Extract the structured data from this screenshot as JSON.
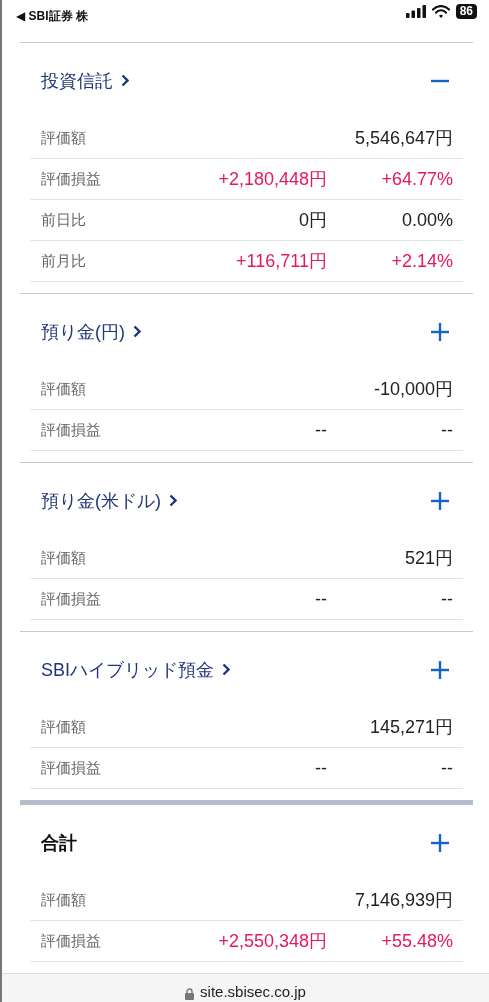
{
  "status_bar": {
    "back_label": "◀ SBI証券 株",
    "battery": "86"
  },
  "sections": [
    {
      "title": "投資信託",
      "link": true,
      "expanded": true,
      "rows": [
        {
          "label": "評価額",
          "amount": {
            "text": "5,546,647円",
            "kind": "plain"
          }
        },
        {
          "label": "評価損益",
          "amount": {
            "text": "+2,180,448円",
            "kind": "gain"
          },
          "rate": {
            "text": "+64.77%",
            "kind": "gain"
          }
        },
        {
          "label": "前日比",
          "amount": {
            "text": "0円",
            "kind": "plain"
          },
          "rate": {
            "text": "0.00%",
            "kind": "plain"
          }
        },
        {
          "label": "前月比",
          "amount": {
            "text": "+116,711円",
            "kind": "gain"
          },
          "rate": {
            "text": "+2.14%",
            "kind": "gain"
          }
        }
      ]
    },
    {
      "title": "預り金(円)",
      "link": true,
      "expanded": false,
      "rows": [
        {
          "label": "評価額",
          "amount": {
            "text": "-10,000円",
            "kind": "plain"
          }
        },
        {
          "label": "評価損益",
          "amount": {
            "text": "--",
            "kind": "plain"
          },
          "rate": {
            "text": "--",
            "kind": "plain"
          }
        }
      ]
    },
    {
      "title": "預り金(米ドル)",
      "link": true,
      "expanded": false,
      "rows": [
        {
          "label": "評価額",
          "amount": {
            "text": "521円",
            "kind": "plain"
          }
        },
        {
          "label": "評価損益",
          "amount": {
            "text": "--",
            "kind": "plain"
          },
          "rate": {
            "text": "--",
            "kind": "plain"
          }
        }
      ]
    },
    {
      "title": "SBIハイブリッド預金",
      "link": true,
      "expanded": false,
      "rows": [
        {
          "label": "評価額",
          "amount": {
            "text": "145,271円",
            "kind": "plain"
          }
        },
        {
          "label": "評価損益",
          "amount": {
            "text": "--",
            "kind": "plain"
          },
          "rate": {
            "text": "--",
            "kind": "plain"
          }
        }
      ]
    },
    {
      "title": "合計",
      "link": false,
      "expanded": false,
      "total": true,
      "rows": [
        {
          "label": "評価額",
          "amount": {
            "text": "7,146,939円",
            "kind": "plain"
          }
        },
        {
          "label": "評価損益",
          "amount": {
            "text": "+2,550,348円",
            "kind": "gain"
          },
          "rate": {
            "text": "+55.48%",
            "kind": "gain"
          }
        }
      ]
    }
  ],
  "address_bar": {
    "url": "site.sbisec.co.jp"
  }
}
